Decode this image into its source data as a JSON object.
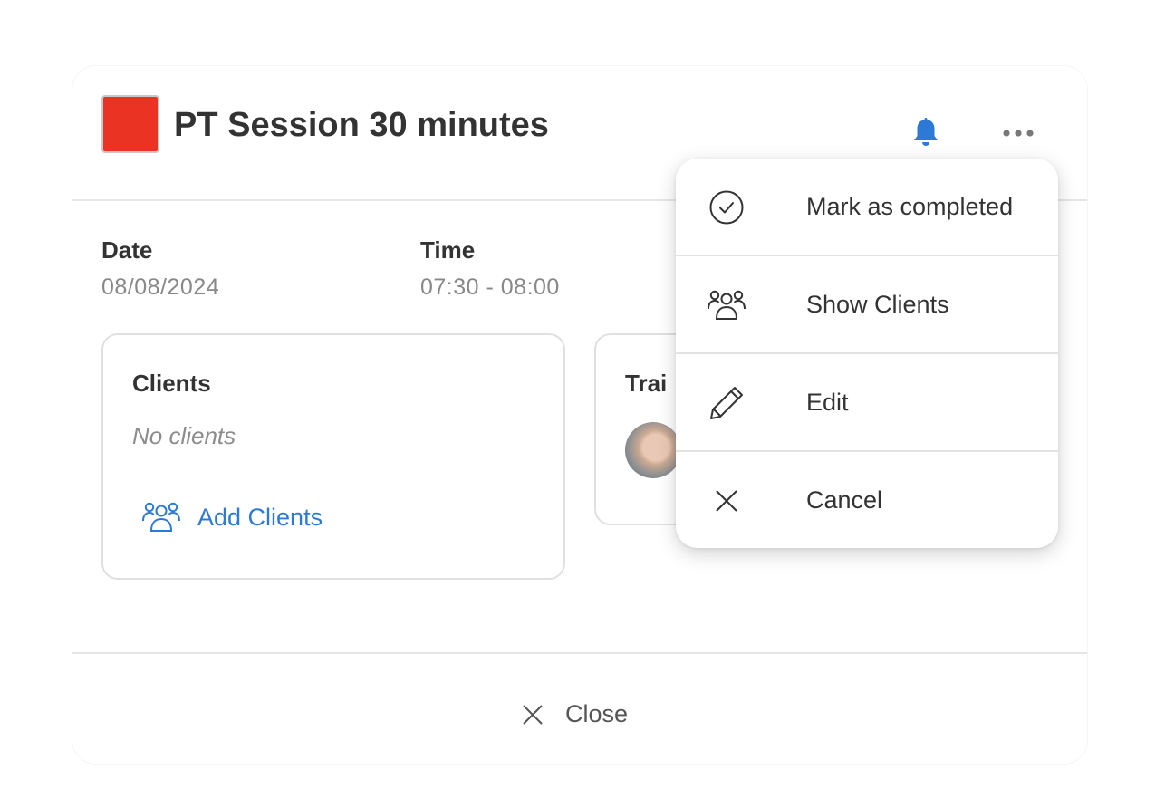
{
  "session": {
    "title": "PT Session 30 minutes",
    "color": "#ea3323"
  },
  "info": {
    "date_label": "Date",
    "date_value": "08/08/2024",
    "time_label": "Time",
    "time_value": "07:30 - 08:00"
  },
  "clients_card": {
    "title": "Clients",
    "empty_text": "No clients",
    "add_label": "Add Clients"
  },
  "trainer_card": {
    "title_visible": "Trai"
  },
  "menu": {
    "items": [
      {
        "label": "Mark as completed",
        "icon": "check-circle-icon"
      },
      {
        "label": "Show Clients",
        "icon": "users-icon"
      },
      {
        "label": "Edit",
        "icon": "pencil-icon"
      },
      {
        "label": "Cancel",
        "icon": "close-icon"
      }
    ]
  },
  "footer": {
    "close_label": "Close"
  },
  "colors": {
    "accent": "#2c79d6",
    "bell": "#2c79d6",
    "text": "#333333",
    "muted": "#888888"
  }
}
